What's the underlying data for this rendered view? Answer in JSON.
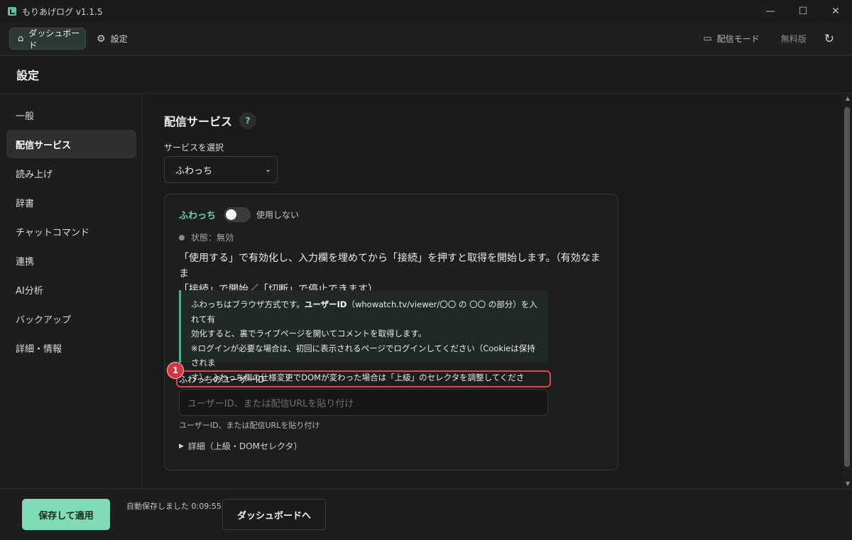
{
  "window": {
    "title": "もりあげログ v1.1.5",
    "controls": [
      "minimize-icon",
      "maximize-icon",
      "close-icon"
    ]
  },
  "topnav": {
    "dashboard_label": "ダッシュボード",
    "settings_label": "設定",
    "stream_mode_label": "配信モード",
    "version_label": "無料版"
  },
  "page": {
    "title": "設定"
  },
  "sidebar": {
    "items": [
      {
        "label": "一般"
      },
      {
        "label": "配信サービス",
        "active": true
      },
      {
        "label": "読み上げ"
      },
      {
        "label": "辞書"
      },
      {
        "label": "チャットコマンド"
      },
      {
        "label": "連携"
      },
      {
        "label": "AI分析"
      },
      {
        "label": "バックアップ"
      },
      {
        "label": "詳細・情報"
      }
    ]
  },
  "main": {
    "section_title": "配信サービス",
    "help_label": "?",
    "select_label": "サービスを選択",
    "selected_service": "ふわっち",
    "card": {
      "service_name": "ふわっち",
      "toggle_on": false,
      "toggle_label": "使用しない",
      "status_text": "状態：無効",
      "instruction_line1": "「使用する」で有効化し、入力欄を埋めてから「接続」を押すと取得を開始します。（有効なまま",
      "instruction_line2": "「接続」で開始／「切断」で停止できます）",
      "info_line1_pre": "ふわっちはブラウザ方式です。",
      "info_line1_bold": "ユーザーID",
      "info_line1_post": "（whowatch.tv/viewer/〇〇 の 〇〇 の部分）を入れて有",
      "info_line2": "効化すると、裏でライブページを開いてコメントを取得します。",
      "info_line3": "※ログインが必要な場合は、初回に表示されるページでログインしてください（Cookieは保持されま",
      "info_line4": "す）。ふわっち側の仕様変更でDOMが変わった場合は「上級」のセレクタを調整してください。",
      "annotation_number": "1",
      "field_label": "ふわっちのユーザーID",
      "field_placeholder": "ユーザーID、または配信URLを貼り付け",
      "field_help": "ユーザーID、または配信URLを貼り付け",
      "details_label": "詳細（上級・DOMセレクタ）"
    }
  },
  "footer": {
    "save_label": "保存して適用",
    "autosave_text": "自動保存しました 0:09:55",
    "dashboard_button": "ダッシュボードへ"
  },
  "colors": {
    "accent": "#7fdcb6",
    "service_name": "#6fd0a8",
    "highlight": "#d94550",
    "background": "#1a1a1a"
  }
}
